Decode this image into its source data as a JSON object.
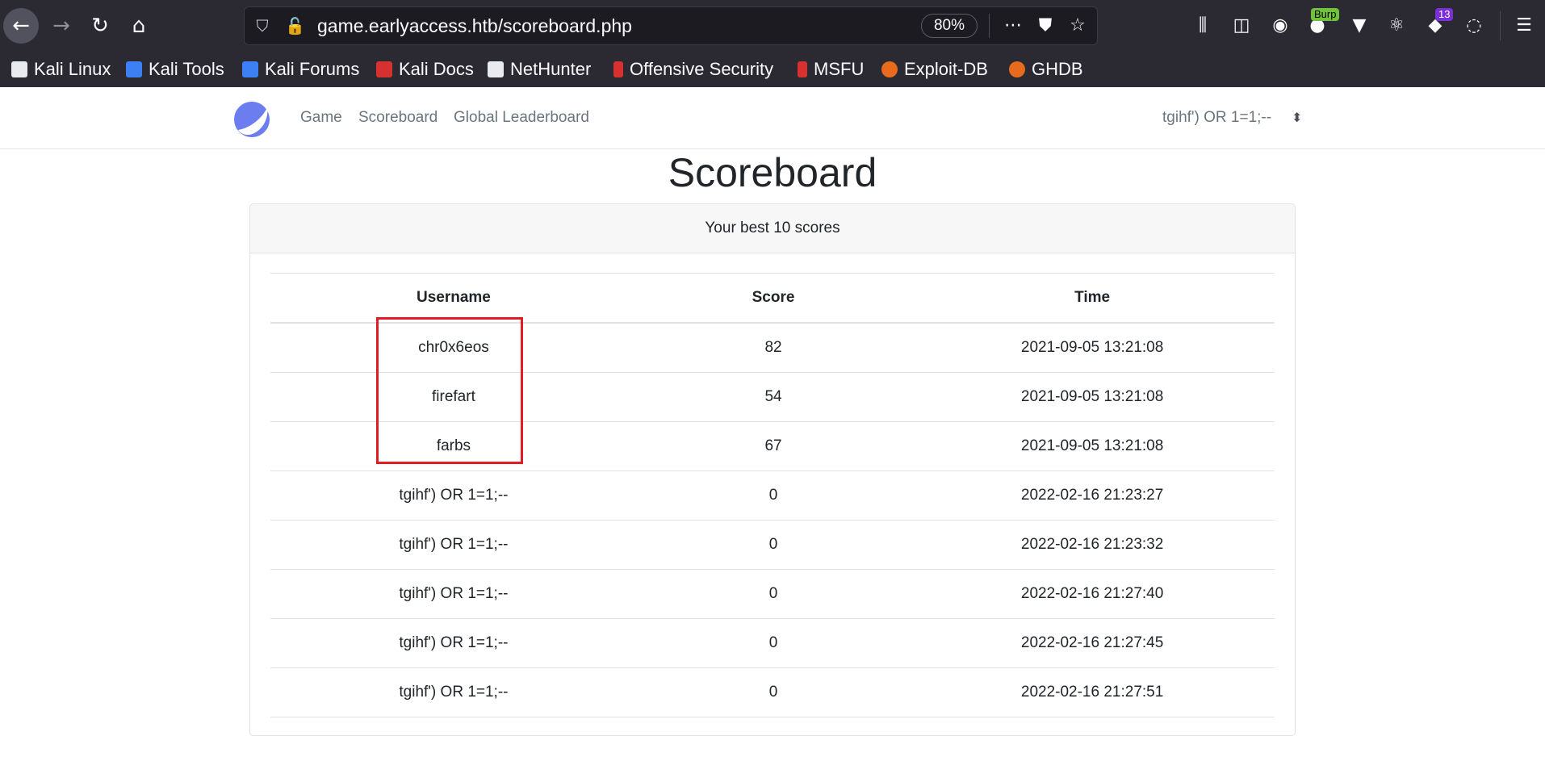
{
  "browser": {
    "url": "game.earlyaccess.htb/scoreboard.php",
    "zoom": "80%",
    "burp_badge": "Burp",
    "extension_count": "13",
    "icons": {
      "back": "back-arrow-icon",
      "forward": "forward-arrow-icon",
      "reload": "reload-icon",
      "home": "home-icon",
      "tracking_protection": "shield-icon",
      "insecure_lock": "insecure-lock-icon",
      "page_actions": "more-dots-icon",
      "pocket": "pocket-icon",
      "bookmark_star": "star-icon",
      "library": "library-icon",
      "sidebar": "sidebar-icon",
      "account": "account-icon",
      "burp_extension": "burp-icon",
      "vue_devtools": "vue-icon",
      "react_devtools": "react-icon",
      "wappalyzer": "wappalyzer-icon",
      "cookie_editor": "cookie-icon",
      "menu": "hamburger-menu-icon"
    }
  },
  "bookmarks": [
    {
      "label": "Kali Linux",
      "icon": "kali-icon"
    },
    {
      "label": "Kali Tools",
      "icon": "kali-icon"
    },
    {
      "label": "Kali Forums",
      "icon": "kali-icon"
    },
    {
      "label": "Kali Docs",
      "icon": "kali-docs-icon"
    },
    {
      "label": "NetHunter",
      "icon": "kali-icon"
    },
    {
      "label": "Offensive Security",
      "icon": "offsec-icon"
    },
    {
      "label": "MSFU",
      "icon": "offsec-icon"
    },
    {
      "label": "Exploit-DB",
      "icon": "exploitdb-icon"
    },
    {
      "label": "GHDB",
      "icon": "exploitdb-icon"
    }
  ],
  "site": {
    "logo": "moon-logo-icon",
    "nav": [
      "Game",
      "Scoreboard",
      "Global Leaderboard"
    ],
    "user": "tgihf') OR 1=1;--",
    "title": "Scoreboard",
    "card_header": "Your best 10 scores"
  },
  "table": {
    "headers": [
      "Username",
      "Score",
      "Time"
    ],
    "rows": [
      [
        "chr0x6eos",
        "82",
        "2021-09-05 13:21:08"
      ],
      [
        "firefart",
        "54",
        "2021-09-05 13:21:08"
      ],
      [
        "farbs",
        "67",
        "2021-09-05 13:21:08"
      ],
      [
        "tgihf') OR 1=1;--",
        "0",
        "2022-02-16 21:23:27"
      ],
      [
        "tgihf') OR 1=1;--",
        "0",
        "2022-02-16 21:23:32"
      ],
      [
        "tgihf') OR 1=1;--",
        "0",
        "2022-02-16 21:27:40"
      ],
      [
        "tgihf') OR 1=1;--",
        "0",
        "2022-02-16 21:27:45"
      ],
      [
        "tgihf') OR 1=1;--",
        "0",
        "2022-02-16 21:27:51"
      ]
    ]
  },
  "colors": {
    "chrome_bg": "#2b2a33",
    "urlbar_bg": "#1c1b22",
    "annotation": "#e31b23",
    "logo": "#6c7df0",
    "burp_badge": "#6fc23a",
    "extension_badge": "#7b2fd6"
  }
}
